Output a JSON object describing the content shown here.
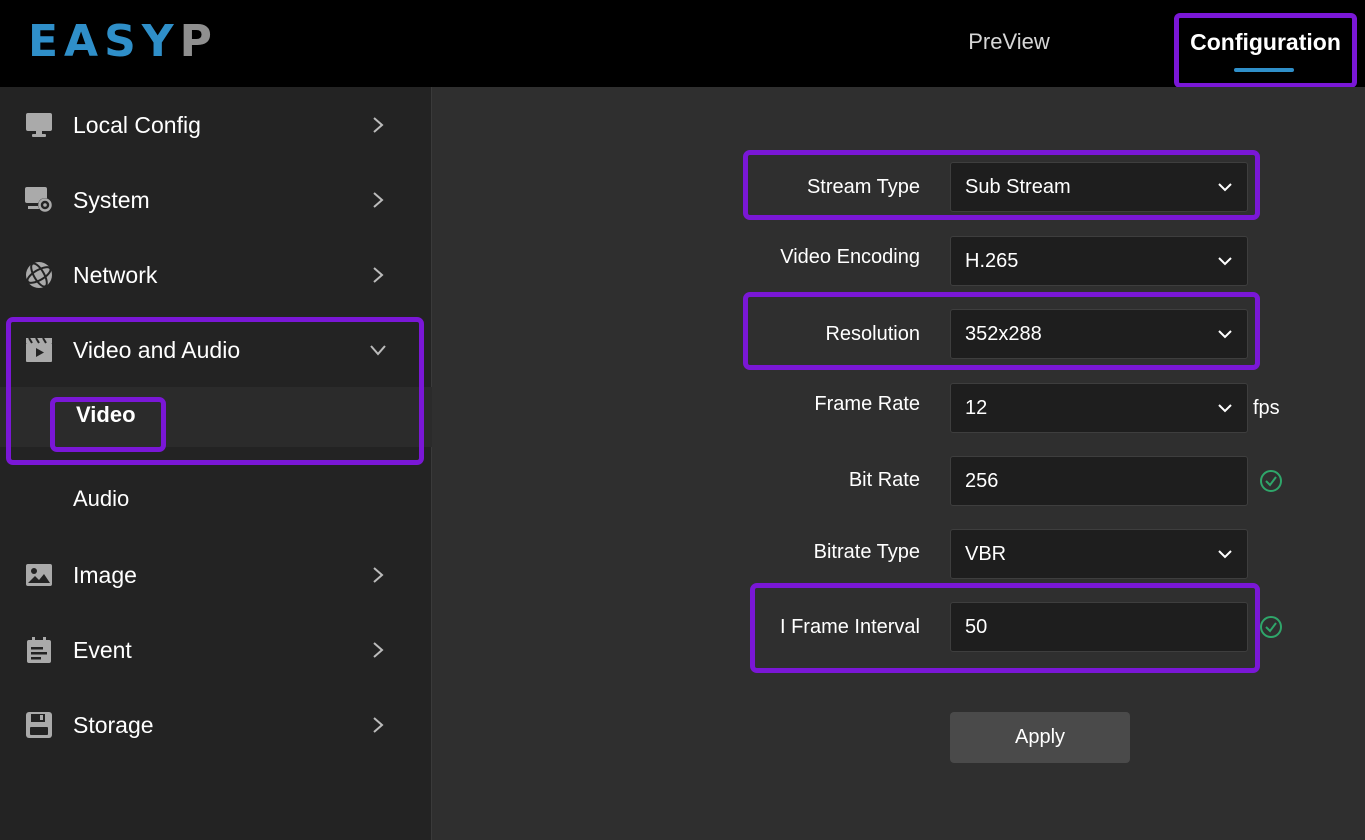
{
  "app": {
    "logo_part1": "EASY",
    "logo_part2": "P"
  },
  "header": {
    "tabs": [
      {
        "label": "PreView",
        "active": false
      },
      {
        "label": "Configuration",
        "active": true
      }
    ]
  },
  "sidebar": {
    "items": [
      {
        "label": "Local Config",
        "icon": "monitor-icon"
      },
      {
        "label": "System",
        "icon": "system-settings-icon"
      },
      {
        "label": "Network",
        "icon": "globe-icon"
      },
      {
        "label": "Video and Audio",
        "icon": "video-clapper-icon",
        "expanded": true,
        "children": [
          {
            "label": "Video",
            "active": true
          },
          {
            "label": "Audio",
            "active": false
          }
        ]
      },
      {
        "label": "Image",
        "icon": "image-icon"
      },
      {
        "label": "Event",
        "icon": "clipboard-icon"
      },
      {
        "label": "Storage",
        "icon": "floppy-disk-icon"
      }
    ]
  },
  "form": {
    "stream_type": {
      "label": "Stream Type",
      "value": "Sub Stream"
    },
    "video_encoding": {
      "label": "Video Encoding",
      "value": "H.265"
    },
    "resolution": {
      "label": "Resolution",
      "value": "352x288"
    },
    "frame_rate": {
      "label": "Frame Rate",
      "value": "12",
      "unit": "fps"
    },
    "bit_rate": {
      "label": "Bit Rate",
      "value": "256"
    },
    "bitrate_type": {
      "label": "Bitrate Type",
      "value": "VBR"
    },
    "i_frame_interval": {
      "label": "I Frame Interval",
      "value": "50"
    },
    "apply_label": "Apply"
  },
  "colors": {
    "accent": "#2f8fc9",
    "highlight": "#7a17d6",
    "ok": "#2fa66a"
  }
}
